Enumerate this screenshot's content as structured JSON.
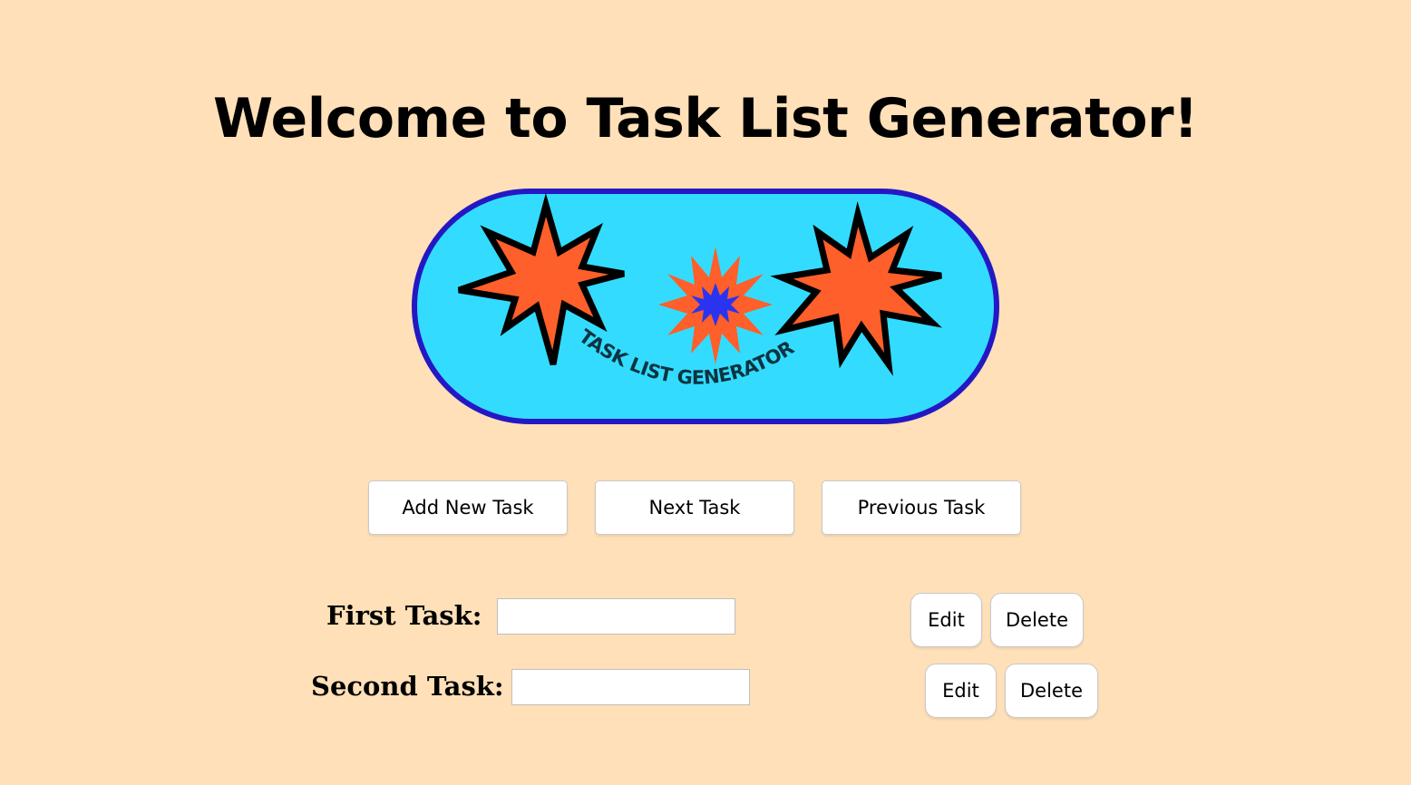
{
  "theme": {
    "background": "#ffe0b8",
    "logo_fill": "#33dcff",
    "logo_border": "#2418c4",
    "star_fill": "#ff5f2a",
    "star_center": "#2a34f0"
  },
  "header": {
    "title": "Welcome to Task List Generator!"
  },
  "logo": {
    "text": "TASK LIST GENERATOR",
    "icons": [
      "starburst-icon",
      "starburst-icon",
      "starburst-icon"
    ]
  },
  "toolbar": {
    "add_label": "Add New Task",
    "next_label": "Next Task",
    "previous_label": "Previous Task"
  },
  "tasks": [
    {
      "label": "First Task:",
      "value": "",
      "edit_label": "Edit",
      "delete_label": "Delete"
    },
    {
      "label": "Second Task:",
      "value": "",
      "edit_label": "Edit",
      "delete_label": "Delete"
    }
  ]
}
